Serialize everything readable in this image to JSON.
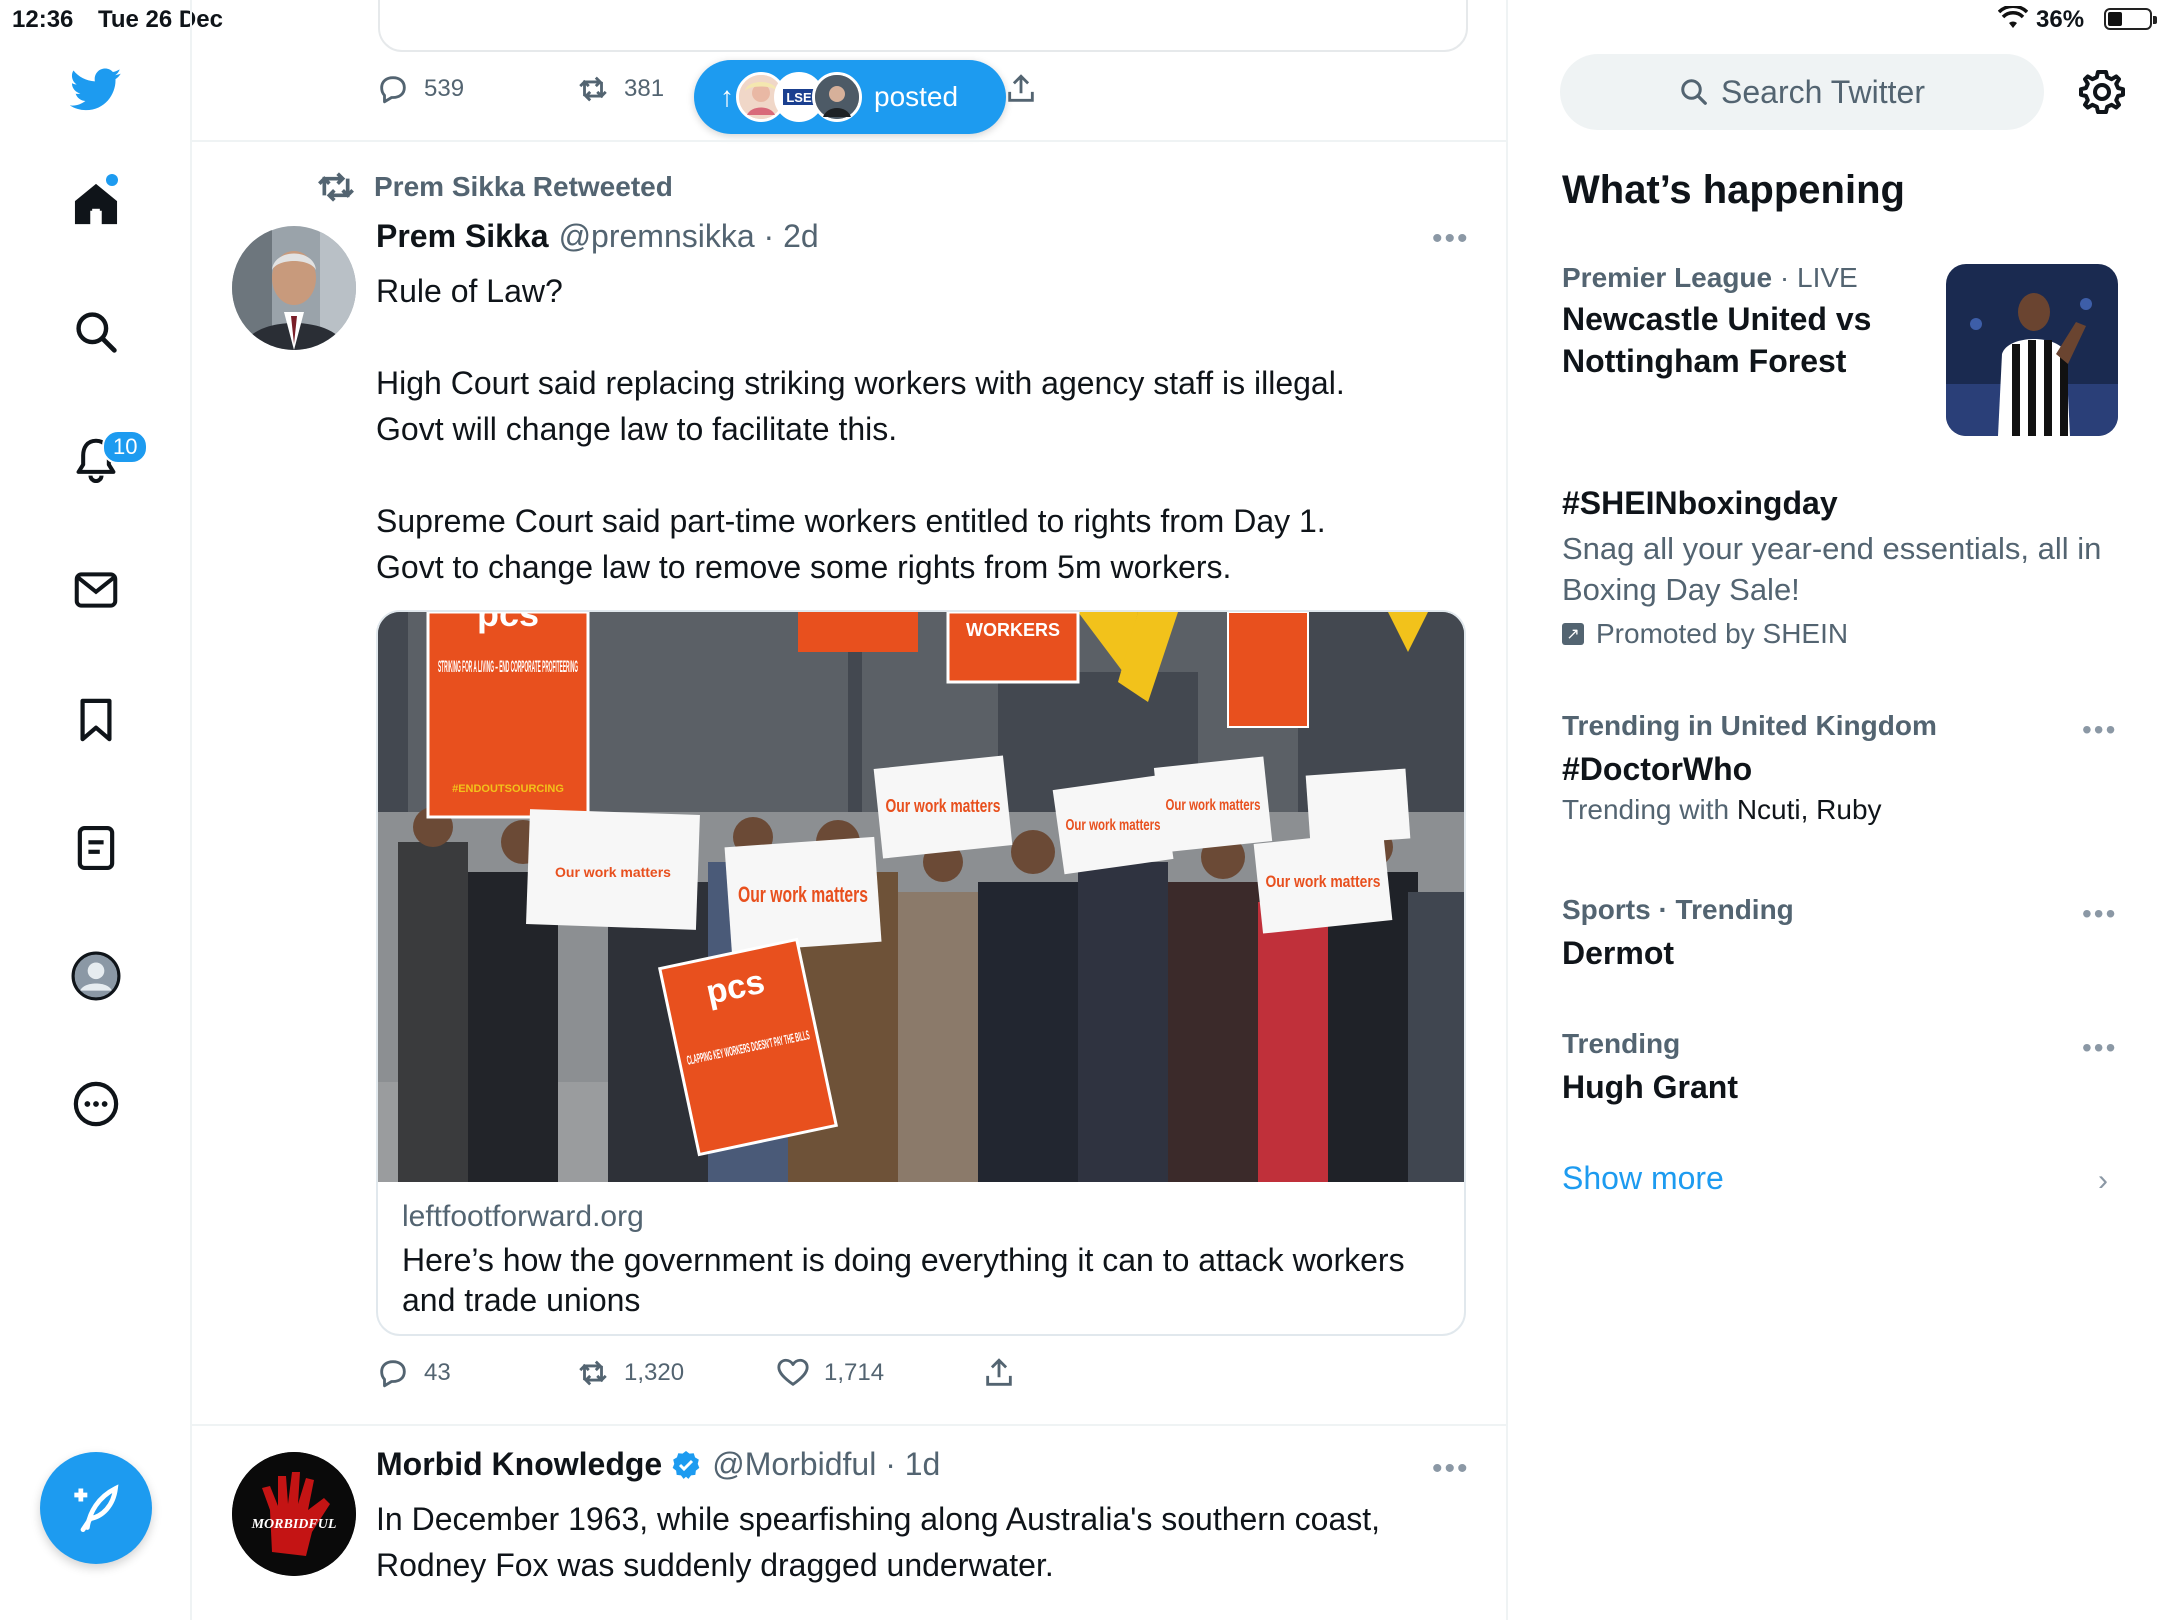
{
  "status_bar": {
    "time": "12:36",
    "date": "Tue 26 Dec",
    "battery": "36%"
  },
  "nav": {
    "notifications_badge": "10"
  },
  "prev_tweet": {
    "replies": "539",
    "retweets": "381"
  },
  "posted_pill": {
    "label": "posted",
    "arrow": "↑"
  },
  "tweet1": {
    "retweeted_by": "Prem Sikka Retweeted",
    "name": "Prem Sikka",
    "handle": "@premnsikka · 2d",
    "text": {
      "line1": "Rule of Law?",
      "line2": "High Court said replacing striking workers with agency staff is illegal.",
      "line3": "Govt will change law to facilitate this.",
      "line4": "Supreme Court said part-time workers entitled to rights from Day 1.",
      "line5": "Govt to change law to remove some rights from 5m workers."
    },
    "card": {
      "domain": "leftfootforward.org",
      "title": "Here’s how the government is doing everything it can to attack workers and trade unions",
      "image_signs": {
        "pcs_banner": "pcs",
        "striking": "STRIKING FOR A LIVING – END CORPORATE PROFITEERING",
        "endoutsourcing": "#ENDOUTSOURCING",
        "workers": "WORKERS",
        "our_work_matters": "Our work matters",
        "clapping": "CLAPPING KEY WORKERS DOESN'T PAY THE BILLS",
        "pcs2": "pcs"
      }
    },
    "replies": "43",
    "retweets": "1,320",
    "likes": "1,714"
  },
  "tweet2": {
    "name": "Morbid Knowledge",
    "handle": "@Morbidful · 1d",
    "avatar_text": "MORBIDFUL",
    "text": {
      "line1": "In December 1963, while spearfishing along Australia's southern coast,",
      "line2": "Rodney Fox was suddenly dragged underwater."
    }
  },
  "sidebar": {
    "search_placeholder": "Search Twitter",
    "title": "What’s happening",
    "trends": [
      {
        "meta_main": "Premier League",
        "meta_sub": " · LIVE",
        "title": "Newcastle United vs Nottingham Forest"
      },
      {
        "title": "#SHEINboxingday",
        "desc": "Snag all your year-end essentials, all in Boxing Day Sale!",
        "promo": "Promoted by SHEIN"
      },
      {
        "meta": "Trending in United Kingdom",
        "title": "#DoctorWho",
        "with_label": "Trending with ",
        "with_names": "Ncuti, Ruby"
      },
      {
        "meta": "Sports · Trending",
        "title": "Dermot"
      },
      {
        "meta": "Trending",
        "title": "Hugh Grant"
      }
    ],
    "show_more": "Show more"
  },
  "colors": {
    "accent": "#1d9bf0",
    "text": "#0f1419",
    "secondary": "#536471",
    "pcs_orange": "#e8501e"
  }
}
